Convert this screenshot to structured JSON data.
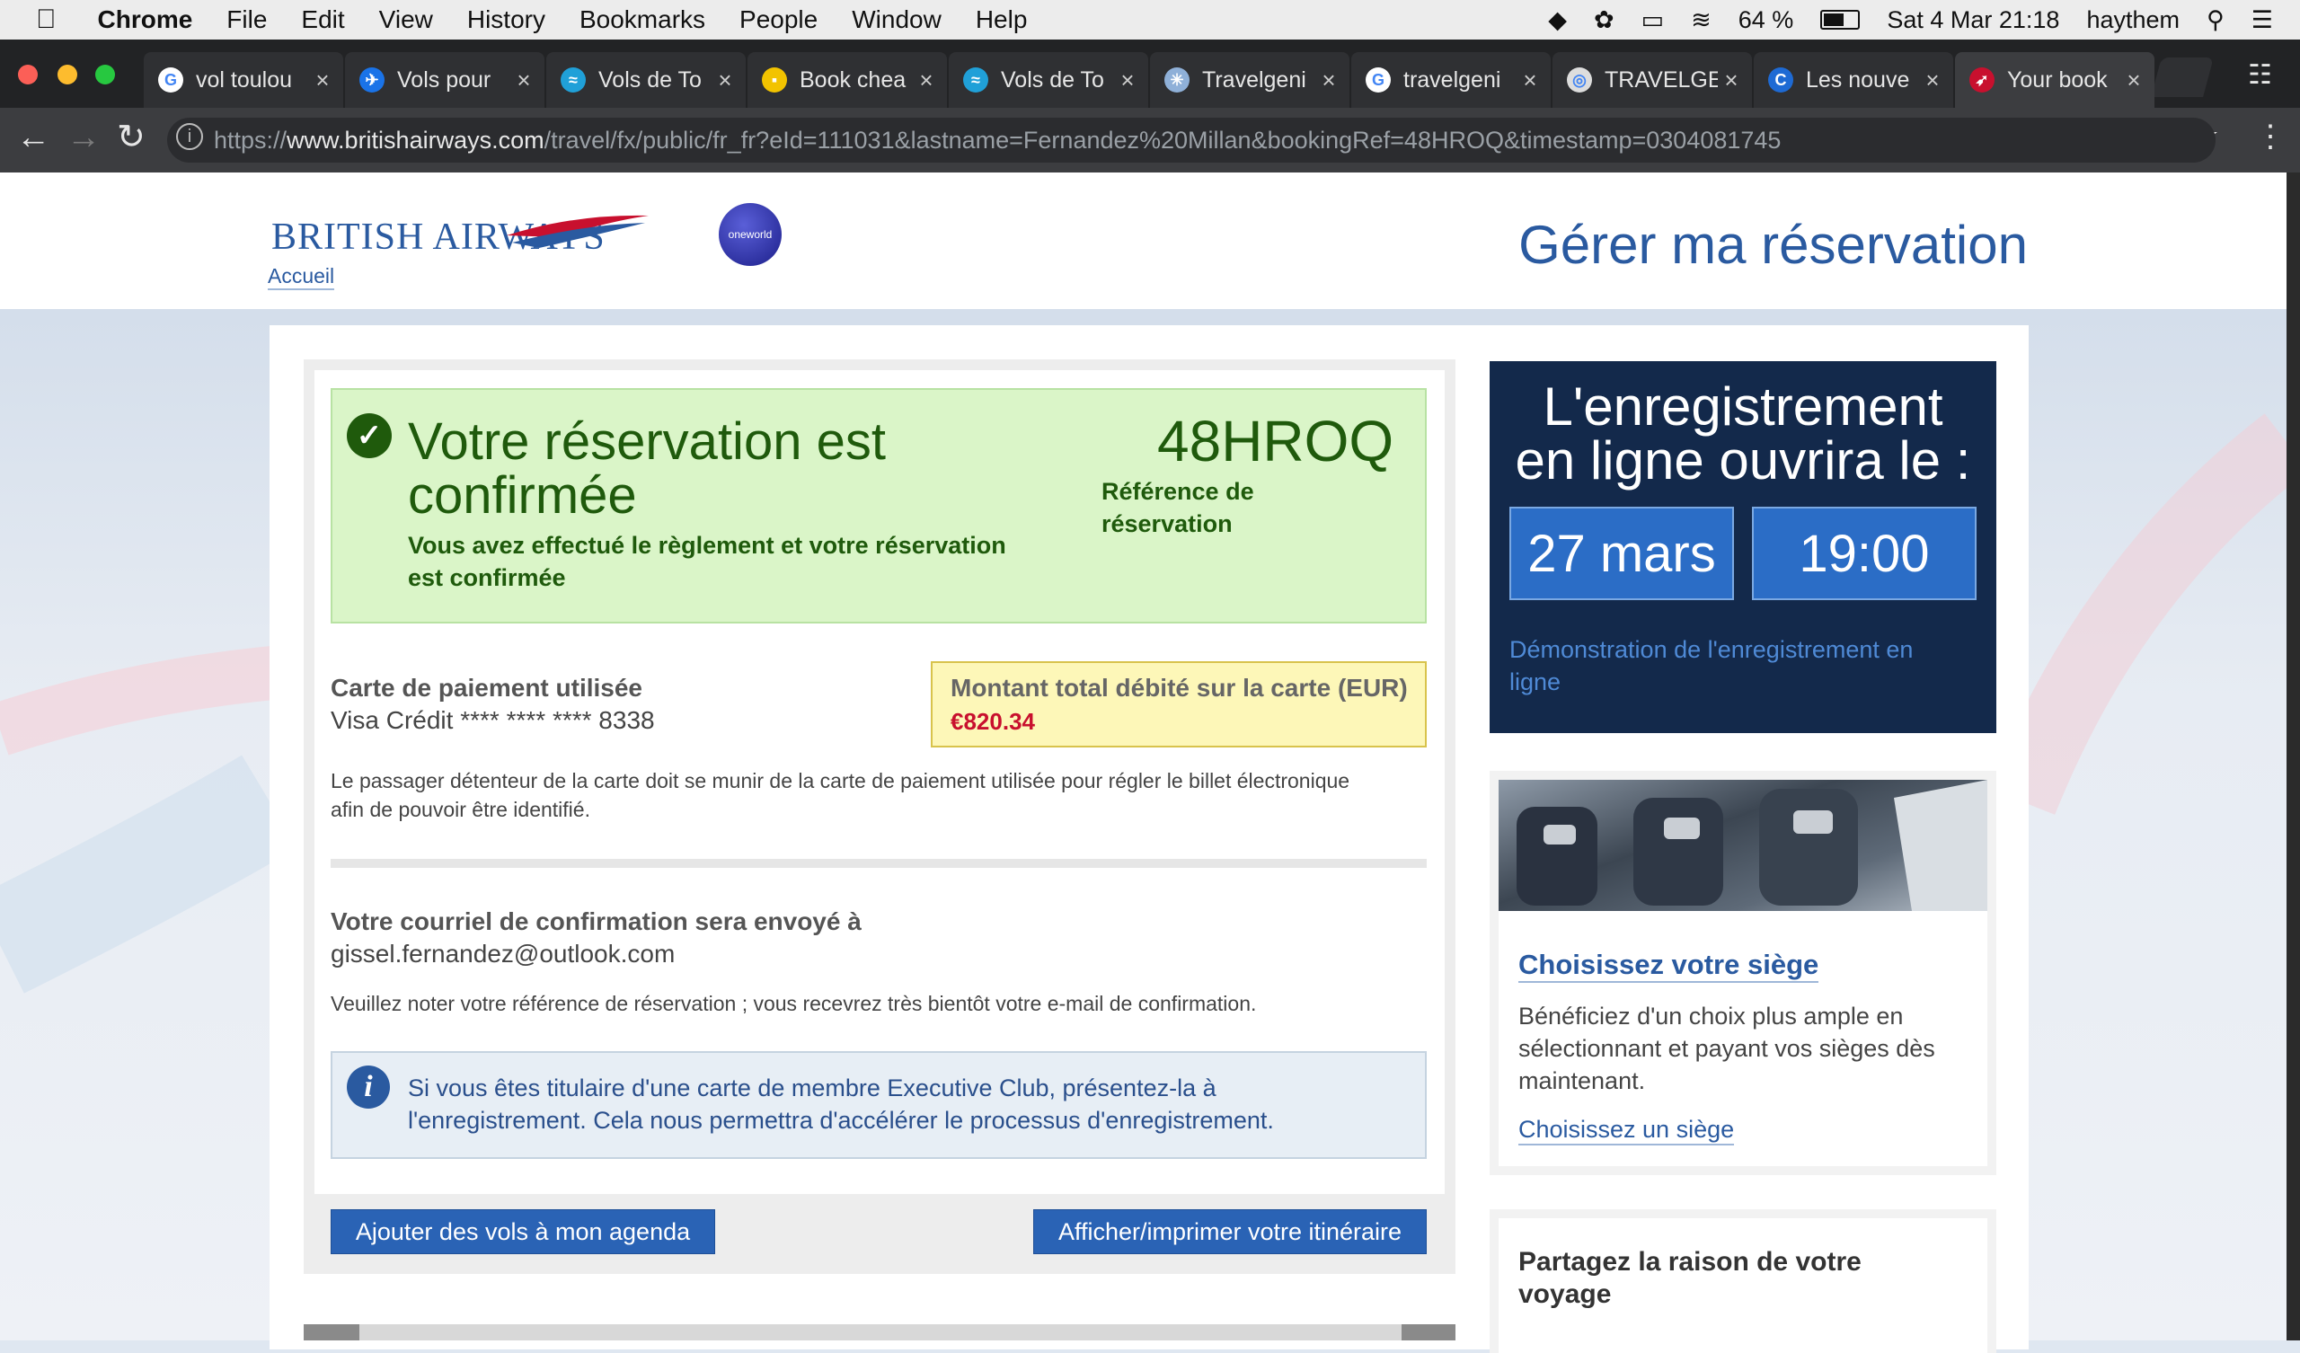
{
  "menubar": {
    "app": "Chrome",
    "items": [
      "File",
      "Edit",
      "View",
      "History",
      "Bookmarks",
      "People",
      "Window",
      "Help"
    ],
    "battery": "64 %",
    "datetime": "Sat 4 Mar  21:18",
    "user": "haythem"
  },
  "tabs": [
    {
      "label": "vol toulou",
      "icon": "G",
      "color": "#ffffff"
    },
    {
      "label": "Vols pour",
      "icon": "✈",
      "color": "#1a73e8"
    },
    {
      "label": "Vols de To",
      "icon": "≈",
      "color": "#20a0d8"
    },
    {
      "label": "Book chea",
      "icon": "▪",
      "color": "#f2c300"
    },
    {
      "label": "Vols de To",
      "icon": "≈",
      "color": "#20a0d8"
    },
    {
      "label": "Travelgeni",
      "icon": "✳",
      "color": "#8fb0d8"
    },
    {
      "label": "travelgeni",
      "icon": "G",
      "color": "#ffffff"
    },
    {
      "label": "TRAVELGE",
      "icon": "◎",
      "color": "#dddddd"
    },
    {
      "label": "Les nouve",
      "icon": "C",
      "color": "#1e6ad4"
    },
    {
      "label": "Your book",
      "icon": "➶",
      "color": "#c8102e"
    }
  ],
  "url": {
    "scheme": "https://",
    "domain": "www.britishairways.com",
    "path": "/travel/fx/public/fr_fr?eId=111031&lastname=Fernandez%20Millan&bookingRef=48HROQ&timestamp=0304081745"
  },
  "header": {
    "brand": "BRITISH AIRWAYS",
    "home_link": "Accueil",
    "alliance": "oneworld",
    "title": "Gérer ma réservation"
  },
  "confirmation": {
    "heading_line1": "Votre réservation est",
    "heading_line2": "confirmée",
    "subtext_line1": "Vous avez effectué le règlement et votre réservation",
    "subtext_line2": "est confirmée",
    "booking_ref": "48HROQ",
    "ref_label_line1": "Référence de",
    "ref_label_line2": "réservation"
  },
  "payment": {
    "label": "Carte de paiement utilisée",
    "card": "Visa Crédit **** **** **** 8338",
    "amount_label": "Montant total débité sur la carte (EUR)",
    "amount": "€820.34",
    "note_line1": "Le passager détenteur de la carte doit se munir de la carte de paiement utilisée pour régler le billet électronique",
    "note_line2": "afin de pouvoir être identifié."
  },
  "email": {
    "label": "Votre courriel de confirmation sera envoyé à",
    "address": "gissel.fernandez@outlook.com",
    "note": "Veuillez noter votre référence de réservation ; vous recevrez très bientôt votre e-mail de confirmation."
  },
  "info": {
    "line1": "Si vous êtes titulaire d'une carte de membre Executive Club, présentez-la à",
    "line2": "l'enregistrement. Cela nous permettra d'accélérer le processus d'enregistrement."
  },
  "buttons": {
    "add_calendar": "Ajouter des vols à mon agenda",
    "print": "Afficher/imprimer votre itinéraire"
  },
  "checkin": {
    "title_line1": "L'enregistrement",
    "title_line2": "en ligne ouvrira le :",
    "date": "27 mars",
    "time": "19:00",
    "demo_line1": "Démonstration de l'enregistrement en",
    "demo_line2": "ligne"
  },
  "seat": {
    "title": "Choisissez votre siège",
    "desc_line1": "Bénéficiez d'un choix plus ample en",
    "desc_line2": "sélectionnant et payant vos sièges dès",
    "desc_line3": "maintenant.",
    "link": "Choisissez un siège"
  },
  "share": {
    "title_line1": "Partagez la raison de votre",
    "title_line2": "voyage"
  },
  "colors": {
    "ba_blue": "#2a5aa0",
    "confirm_green": "#1f5a0c",
    "amount_red": "#c8102e",
    "checkin_navy": "#13294b",
    "button_blue": "#2a63b5"
  }
}
